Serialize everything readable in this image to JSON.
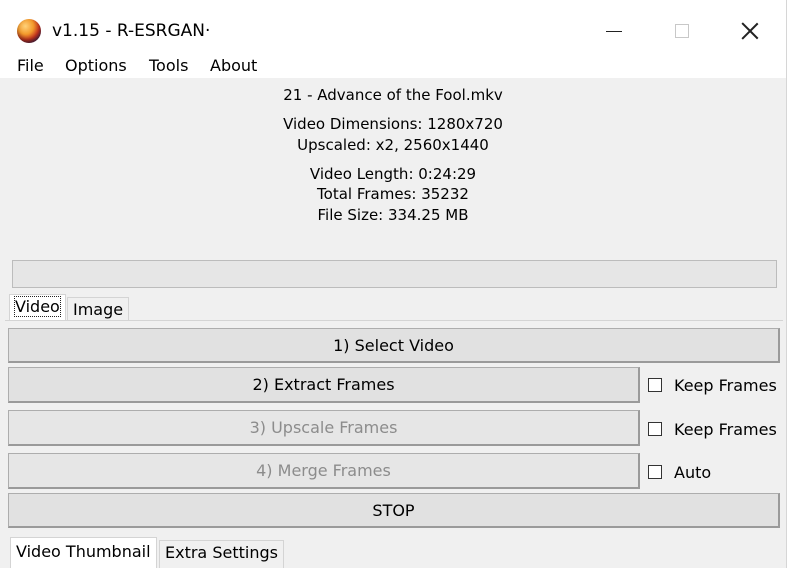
{
  "window": {
    "title": "v1.15 - R-ESRGAN·",
    "icon": "app-orb-icon"
  },
  "menu": [
    "File",
    "Options",
    "Tools",
    "About"
  ],
  "info": {
    "filename": "21 - Advance of the Fool.mkv",
    "dimensions": "Video Dimensions: 1280x720",
    "upscaled": "Upscaled:  x2, 2560x1440",
    "length": "Video Length: 0:24:29",
    "frames": "Total Frames: 35232",
    "size": "File Size: 334.25 MB"
  },
  "progress": {
    "value": 0
  },
  "tabs": {
    "top": [
      "Video",
      "Image"
    ],
    "bottom": [
      "Video Thumbnail",
      "Extra Settings"
    ]
  },
  "buttons": {
    "select": "1) Select Video",
    "extract": "2) Extract Frames",
    "upscale": "3) Upscale Frames",
    "merge": "4) Merge Frames",
    "stop": "STOP"
  },
  "checkboxes": {
    "keep_frames_extract": {
      "label": "Keep Frames",
      "checked": false
    },
    "keep_frames_upscale": {
      "label": "Keep Frames",
      "checked": false
    },
    "auto": {
      "label": "Auto",
      "checked": false
    }
  }
}
